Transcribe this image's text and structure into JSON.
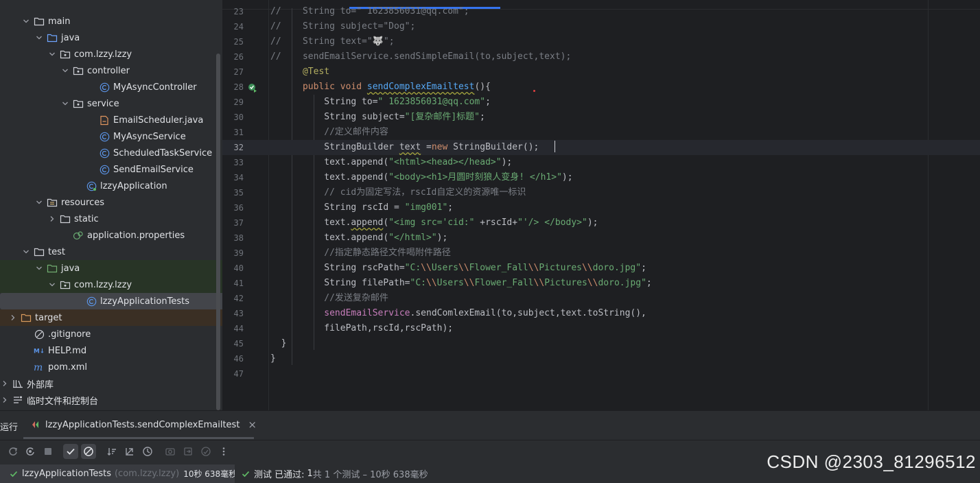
{
  "project_tree": {
    "rows": [
      {
        "label": "main",
        "indent": 1,
        "chevron": "down",
        "icon": "folder-icon",
        "style": ""
      },
      {
        "label": "java",
        "indent": 2,
        "chevron": "down",
        "icon": "source-folder-icon",
        "style": ""
      },
      {
        "label": "com.lzzy.lzzy",
        "indent": 3,
        "chevron": "down",
        "icon": "package-icon",
        "style": ""
      },
      {
        "label": "controller",
        "indent": 4,
        "chevron": "down",
        "icon": "package-icon",
        "style": ""
      },
      {
        "label": "MyAsyncController",
        "indent": 6,
        "chevron": "",
        "icon": "class-icon",
        "style": ""
      },
      {
        "label": "service",
        "indent": 4,
        "chevron": "down",
        "icon": "package-icon",
        "style": ""
      },
      {
        "label": "EmailScheduler.java",
        "indent": 6,
        "chevron": "",
        "icon": "java-file-icon",
        "style": ""
      },
      {
        "label": "MyAsyncService",
        "indent": 6,
        "chevron": "",
        "icon": "class-icon",
        "style": ""
      },
      {
        "label": "ScheduledTaskService",
        "indent": 6,
        "chevron": "",
        "icon": "class-icon",
        "style": ""
      },
      {
        "label": "SendEmailService",
        "indent": 6,
        "chevron": "",
        "icon": "class-icon",
        "style": ""
      },
      {
        "label": "lzzyApplication",
        "indent": 5,
        "chevron": "",
        "icon": "app-class-icon",
        "style": ""
      },
      {
        "label": "resources",
        "indent": 2,
        "chevron": "down",
        "icon": "resources-folder-icon",
        "style": ""
      },
      {
        "label": "static",
        "indent": 3,
        "chevron": "right",
        "icon": "folder-icon",
        "style": ""
      },
      {
        "label": "application.properties",
        "indent": 4,
        "chevron": "",
        "icon": "properties-icon",
        "style": ""
      },
      {
        "label": "test",
        "indent": 1,
        "chevron": "down",
        "icon": "folder-icon",
        "style": ""
      },
      {
        "label": "java",
        "indent": 2,
        "chevron": "down",
        "icon": "test-folder-icon",
        "style": "test-src"
      },
      {
        "label": "com.lzzy.lzzy",
        "indent": 3,
        "chevron": "down",
        "icon": "package-icon",
        "style": "test-src"
      },
      {
        "label": "lzzyApplicationTests",
        "indent": 5,
        "chevron": "",
        "icon": "class-icon",
        "style": "sel"
      },
      {
        "label": "target",
        "indent": 0,
        "chevron": "right",
        "icon": "excluded-folder-icon",
        "style": "excluded"
      },
      {
        "label": ".gitignore",
        "indent": 1,
        "chevron": "",
        "icon": "gitignore-icon",
        "style": ""
      },
      {
        "label": "HELP.md",
        "indent": 1,
        "chevron": "",
        "icon": "markdown-icon",
        "style": ""
      },
      {
        "label": "pom.xml",
        "indent": 1,
        "chevron": "",
        "icon": "maven-icon",
        "style": ""
      },
      {
        "label": "外部库",
        "indent": 0,
        "chevron": "right",
        "icon": "library-icon",
        "style": ""
      },
      {
        "label": "临时文件和控制台",
        "indent": 0,
        "chevron": "right",
        "icon": "scratches-icon",
        "style": ""
      }
    ]
  },
  "editor": {
    "current_line": "32",
    "lines": [
      {
        "n": "23",
        "tokens": [
          [
            "c-comment",
            "//    String to=\" 1623856031@qq.com\";"
          ]
        ]
      },
      {
        "n": "24",
        "tokens": [
          [
            "c-comment",
            "//    String subject=\"Dog\";"
          ]
        ]
      },
      {
        "n": "25",
        "tokens": [
          [
            "c-comment",
            "//    String text=\"🐺\";"
          ]
        ]
      },
      {
        "n": "26",
        "tokens": [
          [
            "c-comment",
            "//    sendEmailService.sendSimpleEmail(to,subject,text);"
          ]
        ]
      },
      {
        "n": "27",
        "tokens": [
          [
            "c-plain",
            "      "
          ],
          [
            "c-ann",
            "@Test"
          ]
        ]
      },
      {
        "n": "28",
        "tokens": [
          [
            "c-plain",
            "      "
          ],
          [
            "c-kw",
            "public void "
          ],
          [
            "c-fn wavy",
            "sendComplexEmailtest"
          ],
          [
            "c-plain",
            "(){"
          ]
        ]
      },
      {
        "n": "29",
        "tokens": [
          [
            "c-plain",
            "          String to="
          ],
          [
            "c-str",
            "\" 1623856031@qq.com\""
          ],
          [
            "c-plain",
            ";"
          ]
        ]
      },
      {
        "n": "30",
        "tokens": [
          [
            "c-plain",
            "          String subject="
          ],
          [
            "c-str",
            "\"[复杂邮件]标题\""
          ],
          [
            "c-plain",
            ";"
          ]
        ]
      },
      {
        "n": "31",
        "tokens": [
          [
            "c-comment",
            "          //定义邮件内容"
          ]
        ]
      },
      {
        "n": "32",
        "tokens": [
          [
            "c-plain",
            "          StringBuilder "
          ],
          [
            "c-plain wavy",
            "text"
          ],
          [
            "c-plain",
            " ="
          ],
          [
            "c-kw",
            "new "
          ],
          [
            "c-plain",
            "StringBuilder();"
          ]
        ]
      },
      {
        "n": "33",
        "tokens": [
          [
            "c-plain",
            "          text.append("
          ],
          [
            "c-str",
            "\"<html><head></head>\""
          ],
          [
            "c-plain",
            ");"
          ]
        ]
      },
      {
        "n": "34",
        "tokens": [
          [
            "c-plain",
            "          text.append("
          ],
          [
            "c-str",
            "\"<body><h1>月圆时刻狼人变身! </h1>\""
          ],
          [
            "c-plain",
            ");"
          ]
        ]
      },
      {
        "n": "35",
        "tokens": [
          [
            "c-comment",
            "          // cid为固定写法，rscId自定义的资源唯一标识"
          ]
        ]
      },
      {
        "n": "36",
        "tokens": [
          [
            "c-plain",
            "          String rscId = "
          ],
          [
            "c-str",
            "\"img001\""
          ],
          [
            "c-plain",
            ";"
          ]
        ]
      },
      {
        "n": "37",
        "tokens": [
          [
            "c-plain",
            "          text."
          ],
          [
            "c-plain wavy",
            "append"
          ],
          [
            "c-plain",
            "("
          ],
          [
            "c-str",
            "\"<img src='cid:\""
          ],
          [
            "c-plain",
            " +rscId+"
          ],
          [
            "c-str",
            "\"'/> </body>\""
          ],
          [
            "c-plain",
            ");"
          ]
        ]
      },
      {
        "n": "38",
        "tokens": [
          [
            "c-plain",
            "          text.append("
          ],
          [
            "c-str",
            "\"</html>\""
          ],
          [
            "c-plain",
            ");"
          ]
        ]
      },
      {
        "n": "39",
        "tokens": [
          [
            "c-comment",
            "          //指定静态路径文件喝附件路径"
          ]
        ]
      },
      {
        "n": "40",
        "tokens": [
          [
            "c-plain",
            "          String rscPath="
          ],
          [
            "c-str",
            "\"C:"
          ],
          [
            "c-esc",
            "\\\\"
          ],
          [
            "c-str",
            "Users"
          ],
          [
            "c-esc",
            "\\\\"
          ],
          [
            "c-str",
            "Flower_Fall"
          ],
          [
            "c-esc",
            "\\\\"
          ],
          [
            "c-str",
            "Pictures"
          ],
          [
            "c-esc",
            "\\\\"
          ],
          [
            "c-str",
            "doro.jpg\""
          ],
          [
            "c-plain",
            ";"
          ]
        ]
      },
      {
        "n": "41",
        "tokens": [
          [
            "c-plain",
            "          String filePath="
          ],
          [
            "c-str",
            "\"C:"
          ],
          [
            "c-esc",
            "\\\\"
          ],
          [
            "c-str",
            "Users"
          ],
          [
            "c-esc",
            "\\\\"
          ],
          [
            "c-str",
            "Flower_Fall"
          ],
          [
            "c-esc",
            "\\\\"
          ],
          [
            "c-str",
            "Pictures"
          ],
          [
            "c-esc",
            "\\\\"
          ],
          [
            "c-str",
            "doro.jpg\""
          ],
          [
            "c-plain",
            ";"
          ]
        ]
      },
      {
        "n": "42",
        "tokens": [
          [
            "c-comment",
            "          //发送复杂邮件"
          ]
        ]
      },
      {
        "n": "43",
        "tokens": [
          [
            "c-plain",
            "          "
          ],
          [
            "c-field",
            "sendEmailService"
          ],
          [
            "c-plain",
            ".sendComlexEmail(to,subject,text.toString(),"
          ]
        ]
      },
      {
        "n": "44",
        "tokens": [
          [
            "c-plain",
            "          filePath,rscId,rscPath);"
          ]
        ]
      },
      {
        "n": "45",
        "tokens": [
          [
            "c-plain",
            "  }"
          ]
        ]
      },
      {
        "n": "46",
        "tokens": [
          [
            "c-plain",
            "}"
          ]
        ]
      },
      {
        "n": "47",
        "tokens": []
      }
    ]
  },
  "run_panel": {
    "title": "运行",
    "tab_label": "lzzyApplicationTests.sendComplexEmailtest",
    "close_glyph": "×",
    "tree_item_label": "lzzyApplicationTests",
    "tree_item_package": "(com.lzzy.lzzy)",
    "tree_item_time": "10秒 638毫秒",
    "status_prefix": "测试 已通过:",
    "status_count": "1",
    "status_rest": "共 1 个测试 – 10秒 638毫秒"
  },
  "watermark": "CSDN @2303_81296512",
  "colors": {
    "accent": "#3574f0",
    "pass": "#5fb865"
  }
}
